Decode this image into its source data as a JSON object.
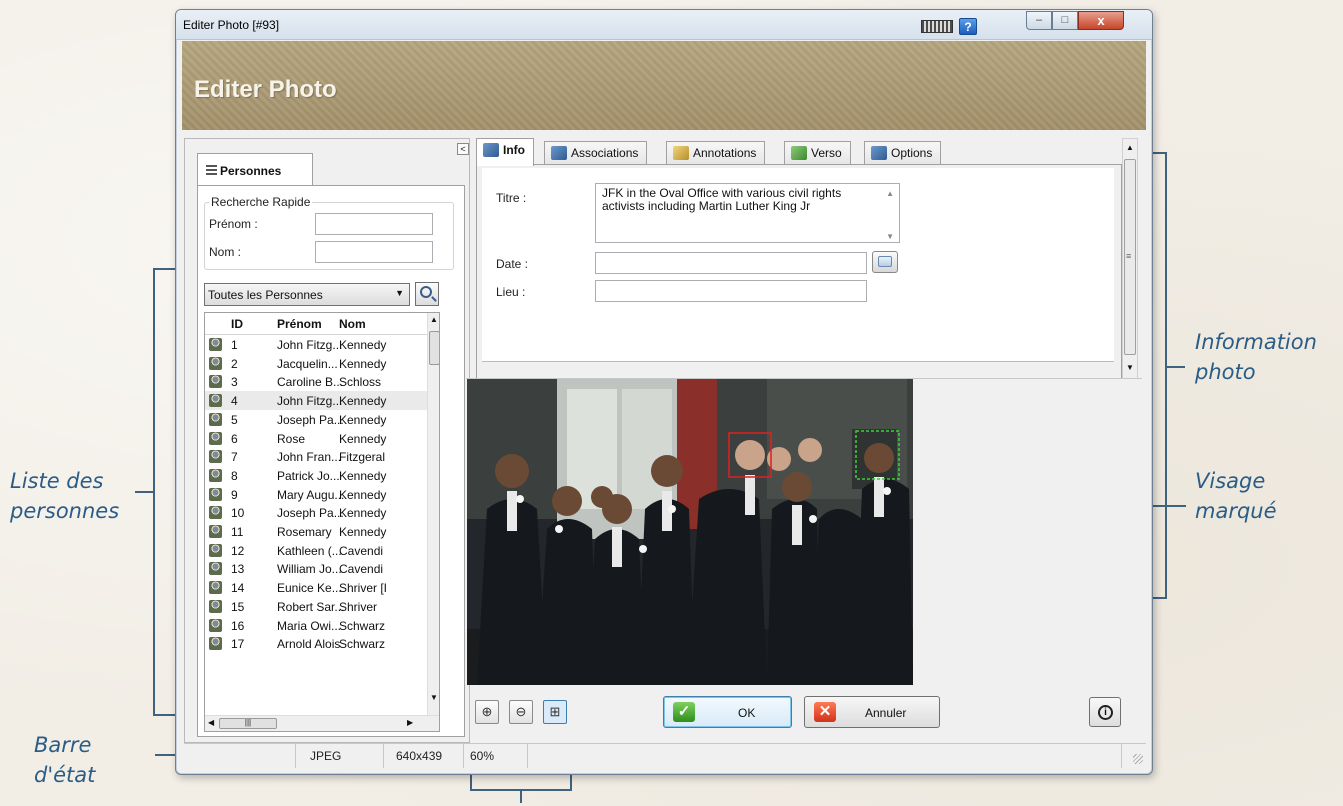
{
  "window": {
    "title": "Editer Photo [#93]",
    "banner_title": "Editer Photo",
    "controls": {
      "minimize": "–",
      "maximize": "□",
      "close": "x"
    },
    "help_label": "?"
  },
  "left_panel": {
    "collapse_label": "<",
    "tab_label": "Personnes",
    "quick_search": {
      "legend": "Recherche Rapide",
      "prenom_label": "Prénom :",
      "prenom_value": "",
      "nom_label": "Nom :",
      "nom_value": ""
    },
    "filter_selected": "Toutes les Personnes",
    "table": {
      "headers": {
        "id": "ID",
        "prenom": "Prénom",
        "nom": "Nom"
      },
      "selected_id": "4",
      "rows": [
        {
          "id": "1",
          "prenom": "John Fitzg...",
          "nom": "Kennedy"
        },
        {
          "id": "2",
          "prenom": "Jacquelin...",
          "nom": "Kennedy"
        },
        {
          "id": "3",
          "prenom": "Caroline B...",
          "nom": "Schloss"
        },
        {
          "id": "4",
          "prenom": "John Fitzg...",
          "nom": "Kennedy"
        },
        {
          "id": "5",
          "prenom": "Joseph Pa...",
          "nom": "Kennedy"
        },
        {
          "id": "6",
          "prenom": "Rose",
          "nom": "Kennedy"
        },
        {
          "id": "7",
          "prenom": "John Fran...",
          "nom": "Fitzgeral"
        },
        {
          "id": "8",
          "prenom": "Patrick Jo...",
          "nom": "Kennedy"
        },
        {
          "id": "9",
          "prenom": "Mary Augu...",
          "nom": "Kennedy"
        },
        {
          "id": "10",
          "prenom": "Joseph Pa...",
          "nom": "Kennedy"
        },
        {
          "id": "11",
          "prenom": "Rosemary",
          "nom": "Kennedy"
        },
        {
          "id": "12",
          "prenom": "Kathleen (...",
          "nom": "Cavendi"
        },
        {
          "id": "13",
          "prenom": "William Jo...",
          "nom": "Cavendi"
        },
        {
          "id": "14",
          "prenom": "Eunice Ke...",
          "nom": "Shriver [I"
        },
        {
          "id": "15",
          "prenom": "Robert Sar...",
          "nom": "Shriver"
        },
        {
          "id": "16",
          "prenom": "Maria Owi...",
          "nom": "Schwarz"
        },
        {
          "id": "17",
          "prenom": "Arnold Alois",
          "nom": "Schwarz"
        }
      ]
    }
  },
  "tabs": [
    {
      "label": "Info",
      "icon": "info-tab-icon",
      "active": true
    },
    {
      "label": "Associations",
      "icon": "associations-tab-icon"
    },
    {
      "label": "Annotations",
      "icon": "annotations-tab-icon"
    },
    {
      "label": "Verso",
      "icon": "verso-tab-icon"
    },
    {
      "label": "Options",
      "icon": "options-tab-icon"
    }
  ],
  "info": {
    "titre_label": "Titre :",
    "titre_value": "JFK in the Oval Office with various civil rights activists including Martin Luther King Jr",
    "date_label": "Date :",
    "date_value": "",
    "lieu_label": "Lieu :",
    "lieu_value": ""
  },
  "buttons": {
    "ok": "OK",
    "annuler": "Annuler",
    "zoom_in": "⊕",
    "zoom_out": "⊖",
    "fit": "⊞"
  },
  "status": {
    "format": "JPEG",
    "dimensions": "640x439",
    "zoom": "60%"
  },
  "annotations": {
    "liste_personnes": "Liste des personnes",
    "barre_etat": "Barre d'état",
    "information_photo": "Information photo",
    "visage_marque": "Visage marqué"
  },
  "colors": {
    "banner": "#ab9a73",
    "callout_text": "#2b5c86",
    "face_marker_red": "#e02020",
    "face_marker_green": "#38d038"
  }
}
